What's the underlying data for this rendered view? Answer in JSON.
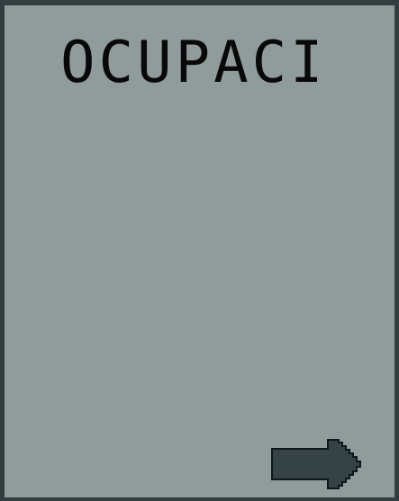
{
  "screen": {
    "title": "OCUPACIÓN"
  },
  "navigation": {
    "next_icon": "right-arrow-icon"
  },
  "colors": {
    "background": "#909b9b",
    "border": "#323d3f",
    "title": "#090909",
    "arrow_fill": "#354246",
    "arrow_outline": "#0f1718"
  }
}
